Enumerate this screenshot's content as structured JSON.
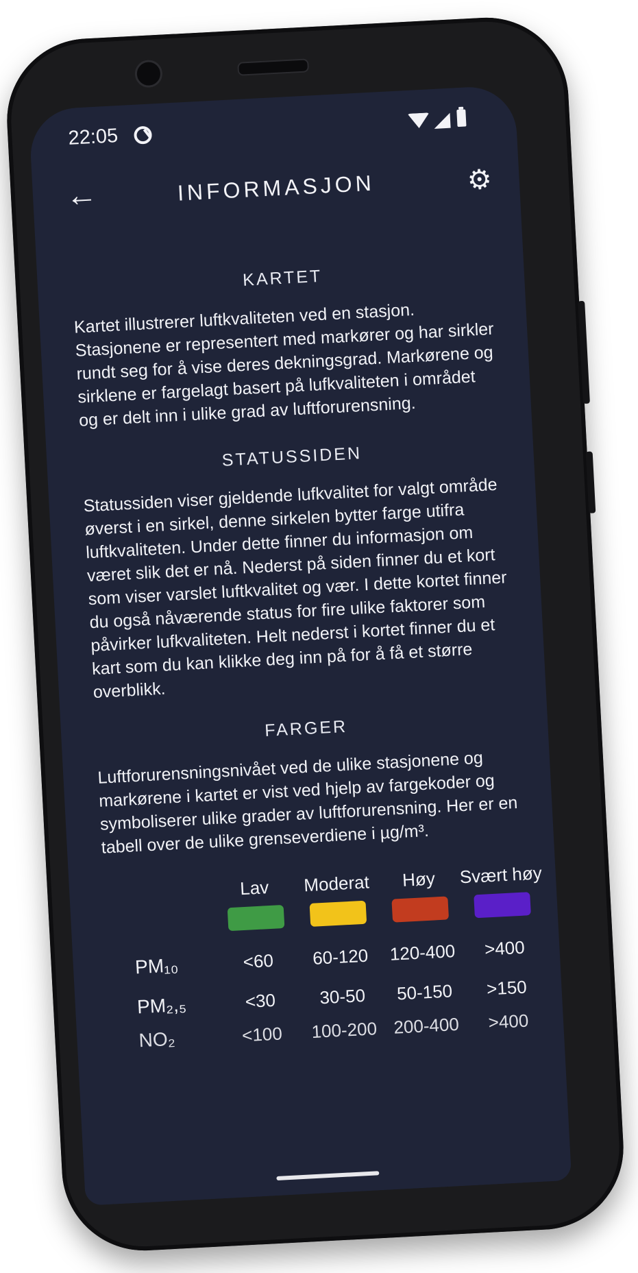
{
  "status_bar": {
    "time": "22:05"
  },
  "app_bar": {
    "title": "INFORMASJON"
  },
  "sections": [
    {
      "title": "KARTET",
      "body": "Kartet illustrerer luftkvaliteten ved en stasjon. Stasjonene er representert med markører og har sirkler rundt seg for å vise deres dekningsgrad. Markørene og sirklene er fargelagt basert på lufkvaliteten i området og er delt inn i ulike grad av luftforurensning."
    },
    {
      "title": "STATUSSIDEN",
      "body": "Statussiden viser gjeldende lufkvalitet for valgt område øverst i en sirkel, denne sirkelen bytter farge utifra luftkvaliteten. Under dette finner du informasjon om været slik det er nå. Nederst på siden finner du et kort som viser varslet luftkvalitet og vær. I dette kortet finner du også nåværende status for fire ulike faktorer som påvirker lufkvaliteten. Helt nederst i kortet finner du et kart som du kan klikke deg inn på for å få et større overblikk."
    },
    {
      "title": "FARGER",
      "body": "Luftforurensningsnivået ved de ulike stasjonene og markørene i kartet er vist ved hjelp av fargekoder og symboliserer ulike grader av luftforurensning. Her er en tabell over de ulike grenseverdiene i µg/m³."
    }
  ],
  "levels_table": {
    "headers": [
      "Lav",
      "Moderat",
      "Høy",
      "Svært høy"
    ],
    "colors": [
      "#3f9b45",
      "#f2c31a",
      "#c23c1f",
      "#5a1fc8"
    ],
    "rows": [
      {
        "label": "PM₁₀",
        "values": [
          "<60",
          "60-120",
          "120-400",
          ">400"
        ]
      },
      {
        "label": "PM₂,₅",
        "values": [
          "<30",
          "30-50",
          "50-150",
          ">150"
        ]
      },
      {
        "label": "NO₂",
        "values": [
          "<100",
          "100-200",
          "200-400",
          ">400"
        ]
      }
    ]
  },
  "icons": {
    "back": "arrow-left-icon",
    "settings": "gear-icon",
    "sync": "sync-icon",
    "wifi": "wifi-icon",
    "signal": "signal-icon",
    "battery": "battery-icon"
  },
  "theme": {
    "background": "#1f2438",
    "text": "#f1f2f6",
    "device": "#1b1b1d"
  }
}
